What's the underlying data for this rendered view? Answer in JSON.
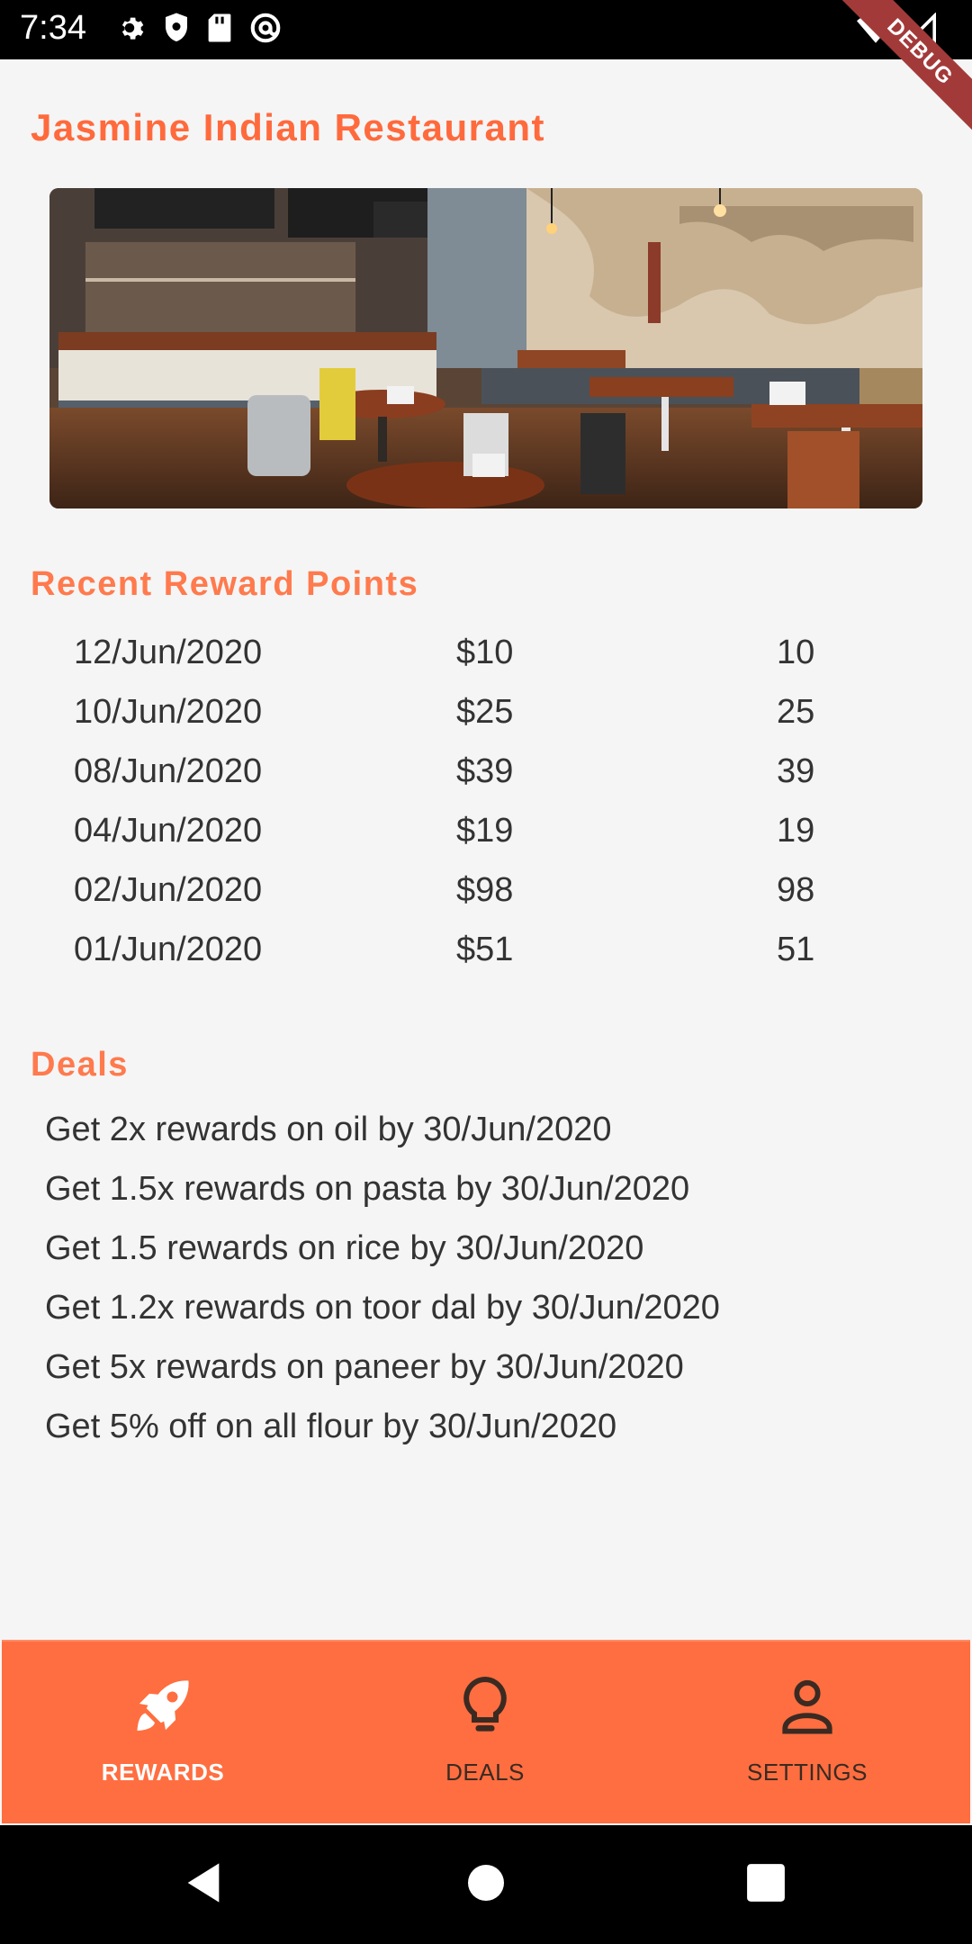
{
  "status_bar": {
    "time": "7:34",
    "debug_label": "DEBUG"
  },
  "restaurant": {
    "name": "Jasmine Indian Restaurant"
  },
  "rewards": {
    "title": "Recent Reward Points",
    "rows": [
      {
        "date": "12/Jun/2020",
        "amount": "$10",
        "points": "10"
      },
      {
        "date": "10/Jun/2020",
        "amount": "$25",
        "points": "25"
      },
      {
        "date": "08/Jun/2020",
        "amount": "$39",
        "points": "39"
      },
      {
        "date": "04/Jun/2020",
        "amount": "$19",
        "points": "19"
      },
      {
        "date": "02/Jun/2020",
        "amount": "$98",
        "points": "98"
      },
      {
        "date": "01/Jun/2020",
        "amount": "$51",
        "points": "51"
      }
    ]
  },
  "deals": {
    "title": "Deals",
    "items": [
      "Get 2x rewards on oil by 30/Jun/2020",
      "Get 1.5x rewards on pasta by 30/Jun/2020",
      "Get 1.5 rewards on rice by 30/Jun/2020",
      "Get 1.2x rewards on toor dal by 30/Jun/2020",
      "Get 5x rewards on paneer by 30/Jun/2020",
      "Get 5% off on all flour by 30/Jun/2020"
    ]
  },
  "bottom_nav": {
    "items": [
      {
        "label": "REWARDS",
        "icon": "rocket-icon",
        "active": true
      },
      {
        "label": "DEALS",
        "icon": "lightbulb-icon",
        "active": false
      },
      {
        "label": "SETTINGS",
        "icon": "person-icon",
        "active": false
      }
    ]
  },
  "colors": {
    "accent": "#ff6e40",
    "title": "#ff6a3d",
    "text": "#333333",
    "background": "#f5f5f5"
  }
}
